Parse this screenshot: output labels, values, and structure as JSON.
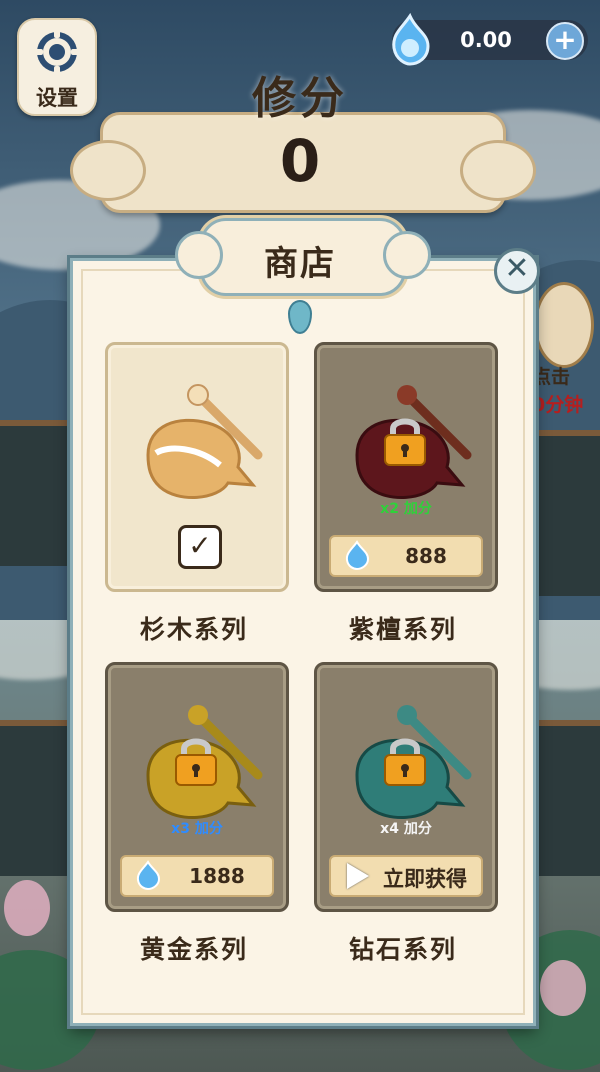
{
  "header": {
    "settings_label": "设置",
    "currency_value": "0.00",
    "plus_label": "+",
    "score_title": "修分",
    "score_value": "0"
  },
  "side": {
    "right_text_1": "点击",
    "right_text_2": "0分钟"
  },
  "shop": {
    "title": "商店",
    "close_label": "✕",
    "items": [
      {
        "name": "杉木系列",
        "selected": true,
        "check": "✓",
        "wood_color": "#e8c27a",
        "shell_color": "#f2dba3"
      },
      {
        "name": "紫檀系列",
        "selected": false,
        "multiplier": "x2 加分",
        "multiplier_color": "#2fd13a",
        "price": "888",
        "wood_color": "#6a1a1e"
      },
      {
        "name": "黄金系列",
        "selected": false,
        "multiplier": "x3 加分",
        "multiplier_color": "#2f8cff",
        "price": "1888",
        "wood_color": "#c9a227"
      },
      {
        "name": "钻石系列",
        "selected": false,
        "multiplier": "x4 加分",
        "multiplier_color": "#f5f5f5",
        "action": "立即获得",
        "wood_color": "#2f7d78"
      }
    ]
  },
  "colors": {
    "accent": "#8fb0b8",
    "panel": "#fbf4e6",
    "lock_gold": "#f0a020"
  }
}
